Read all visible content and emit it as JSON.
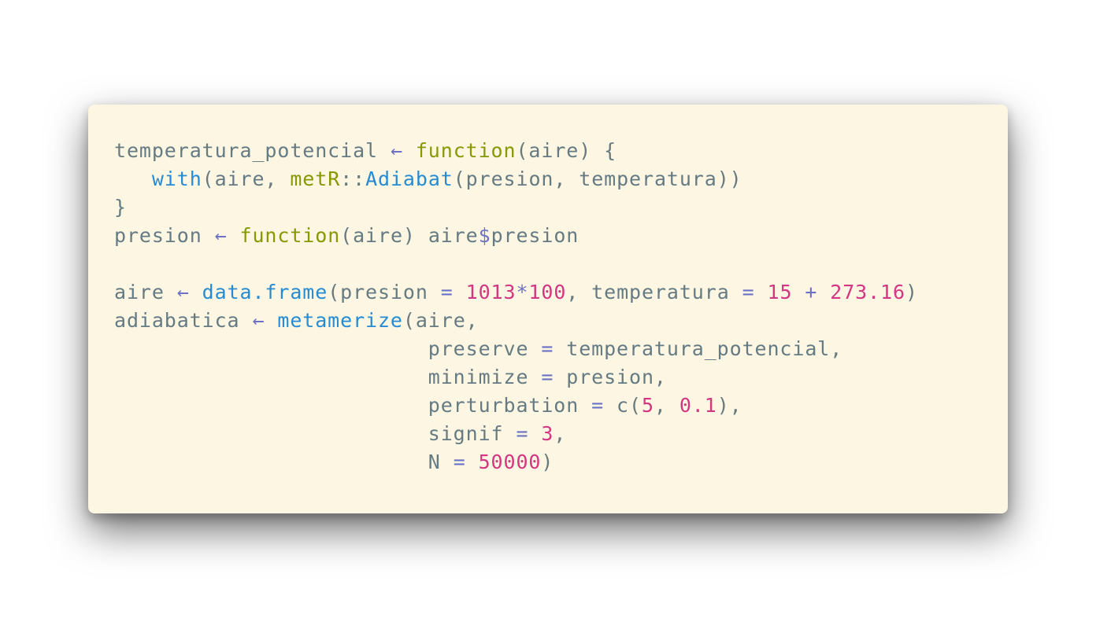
{
  "code": {
    "lines": [
      [
        {
          "t": "temperatura_potencial",
          "k": "id"
        },
        {
          "t": " ",
          "k": "pn"
        },
        {
          "t": "←",
          "k": "op"
        },
        {
          "t": " ",
          "k": "pn"
        },
        {
          "t": "function",
          "k": "kw"
        },
        {
          "t": "(aire) {",
          "k": "pn"
        }
      ],
      [
        {
          "t": "   ",
          "k": "pn"
        },
        {
          "t": "with",
          "k": "fn"
        },
        {
          "t": "(aire, ",
          "k": "pn"
        },
        {
          "t": "metR",
          "k": "kw"
        },
        {
          "t": "::",
          "k": "pn"
        },
        {
          "t": "Adiabat",
          "k": "fn"
        },
        {
          "t": "(presion, temperatura))",
          "k": "pn"
        }
      ],
      [
        {
          "t": "}",
          "k": "pn"
        }
      ],
      [
        {
          "t": "presion",
          "k": "id"
        },
        {
          "t": " ",
          "k": "pn"
        },
        {
          "t": "←",
          "k": "op"
        },
        {
          "t": " ",
          "k": "pn"
        },
        {
          "t": "function",
          "k": "kw"
        },
        {
          "t": "(aire) aire",
          "k": "pn"
        },
        {
          "t": "$",
          "k": "op"
        },
        {
          "t": "presion",
          "k": "id"
        }
      ],
      [],
      [
        {
          "t": "aire",
          "k": "id"
        },
        {
          "t": " ",
          "k": "pn"
        },
        {
          "t": "←",
          "k": "op"
        },
        {
          "t": " ",
          "k": "pn"
        },
        {
          "t": "data.frame",
          "k": "fn"
        },
        {
          "t": "(presion ",
          "k": "pn"
        },
        {
          "t": "=",
          "k": "eq"
        },
        {
          "t": " ",
          "k": "pn"
        },
        {
          "t": "1013",
          "k": "num"
        },
        {
          "t": "*",
          "k": "op"
        },
        {
          "t": "100",
          "k": "num"
        },
        {
          "t": ", temperatura ",
          "k": "pn"
        },
        {
          "t": "=",
          "k": "eq"
        },
        {
          "t": " ",
          "k": "pn"
        },
        {
          "t": "15",
          "k": "num"
        },
        {
          "t": " ",
          "k": "pn"
        },
        {
          "t": "+",
          "k": "op"
        },
        {
          "t": " ",
          "k": "pn"
        },
        {
          "t": "273.16",
          "k": "num"
        },
        {
          "t": ")",
          "k": "pn"
        }
      ],
      [
        {
          "t": "adiabatica",
          "k": "id"
        },
        {
          "t": " ",
          "k": "pn"
        },
        {
          "t": "←",
          "k": "op"
        },
        {
          "t": " ",
          "k": "pn"
        },
        {
          "t": "metamerize",
          "k": "fn"
        },
        {
          "t": "(aire,",
          "k": "pn"
        }
      ],
      [
        {
          "t": "                         preserve ",
          "k": "pn"
        },
        {
          "t": "=",
          "k": "eq"
        },
        {
          "t": " temperatura_potencial,",
          "k": "pn"
        }
      ],
      [
        {
          "t": "                         minimize ",
          "k": "pn"
        },
        {
          "t": "=",
          "k": "eq"
        },
        {
          "t": " presion,",
          "k": "pn"
        }
      ],
      [
        {
          "t": "                         perturbation ",
          "k": "pn"
        },
        {
          "t": "=",
          "k": "eq"
        },
        {
          "t": " c(",
          "k": "pn"
        },
        {
          "t": "5",
          "k": "num"
        },
        {
          "t": ", ",
          "k": "pn"
        },
        {
          "t": "0.1",
          "k": "num"
        },
        {
          "t": "),",
          "k": "pn"
        }
      ],
      [
        {
          "t": "                         signif ",
          "k": "pn"
        },
        {
          "t": "=",
          "k": "eq"
        },
        {
          "t": " ",
          "k": "pn"
        },
        {
          "t": "3",
          "k": "num"
        },
        {
          "t": ",",
          "k": "pn"
        }
      ],
      [
        {
          "t": "                         N ",
          "k": "pn"
        },
        {
          "t": "=",
          "k": "eq"
        },
        {
          "t": " ",
          "k": "pn"
        },
        {
          "t": "50000",
          "k": "num"
        },
        {
          "t": ")",
          "k": "pn"
        }
      ]
    ]
  }
}
